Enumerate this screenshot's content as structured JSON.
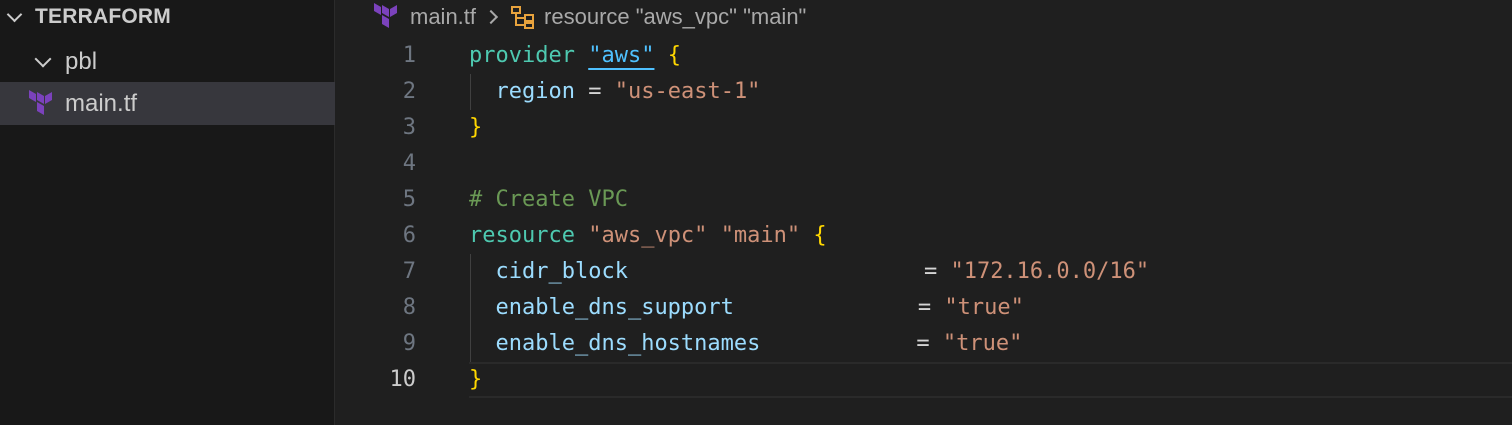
{
  "explorer": {
    "root_label": "TERRAFORM",
    "folder_label": "pbl",
    "file_label": "main.tf",
    "file_icon": "terraform-icon"
  },
  "breadcrumb": {
    "file": "main.tf",
    "symbol": "resource \"aws_vpc\" \"main\"",
    "symbol_icon": "symbol-structure-icon"
  },
  "editor": {
    "current_line": 10,
    "lines": [
      {
        "n": "1"
      },
      {
        "n": "2"
      },
      {
        "n": "3"
      },
      {
        "n": "4"
      },
      {
        "n": "5"
      },
      {
        "n": "6"
      },
      {
        "n": "7"
      },
      {
        "n": "8"
      },
      {
        "n": "9"
      },
      {
        "n": "10"
      }
    ],
    "tokens": {
      "l1_kw": "provider",
      "l1_str": "\"aws\"",
      "l1_brace": "{",
      "l2_attr": "region",
      "l2_eq": "=",
      "l2_str": "\"us-east-1\"",
      "l3_brace": "}",
      "l5_comment": "# Create VPC",
      "l6_kw": "resource",
      "l6_str1": "\"aws_vpc\"",
      "l6_str2": "\"main\"",
      "l6_brace": "{",
      "l7_attr": "cidr_block",
      "l7_eq": "=",
      "l7_str": "\"172.16.0.0/16\"",
      "l8_attr": "enable_dns_support",
      "l8_eq": "=",
      "l8_str": "\"true\"",
      "l9_attr": "enable_dns_hostnames",
      "l9_eq": "=",
      "l9_str": "\"true\"",
      "l10_brace": "}"
    }
  },
  "colors": {
    "keyword": "#4ec9b0",
    "string": "#ce9178",
    "attribute": "#9cdcfe",
    "brace": "#ffd700",
    "comment": "#6a9955",
    "link": "#4fc1ff",
    "terraform_purple": "#7b42bc",
    "symbol_orange": "#e8a33d"
  }
}
